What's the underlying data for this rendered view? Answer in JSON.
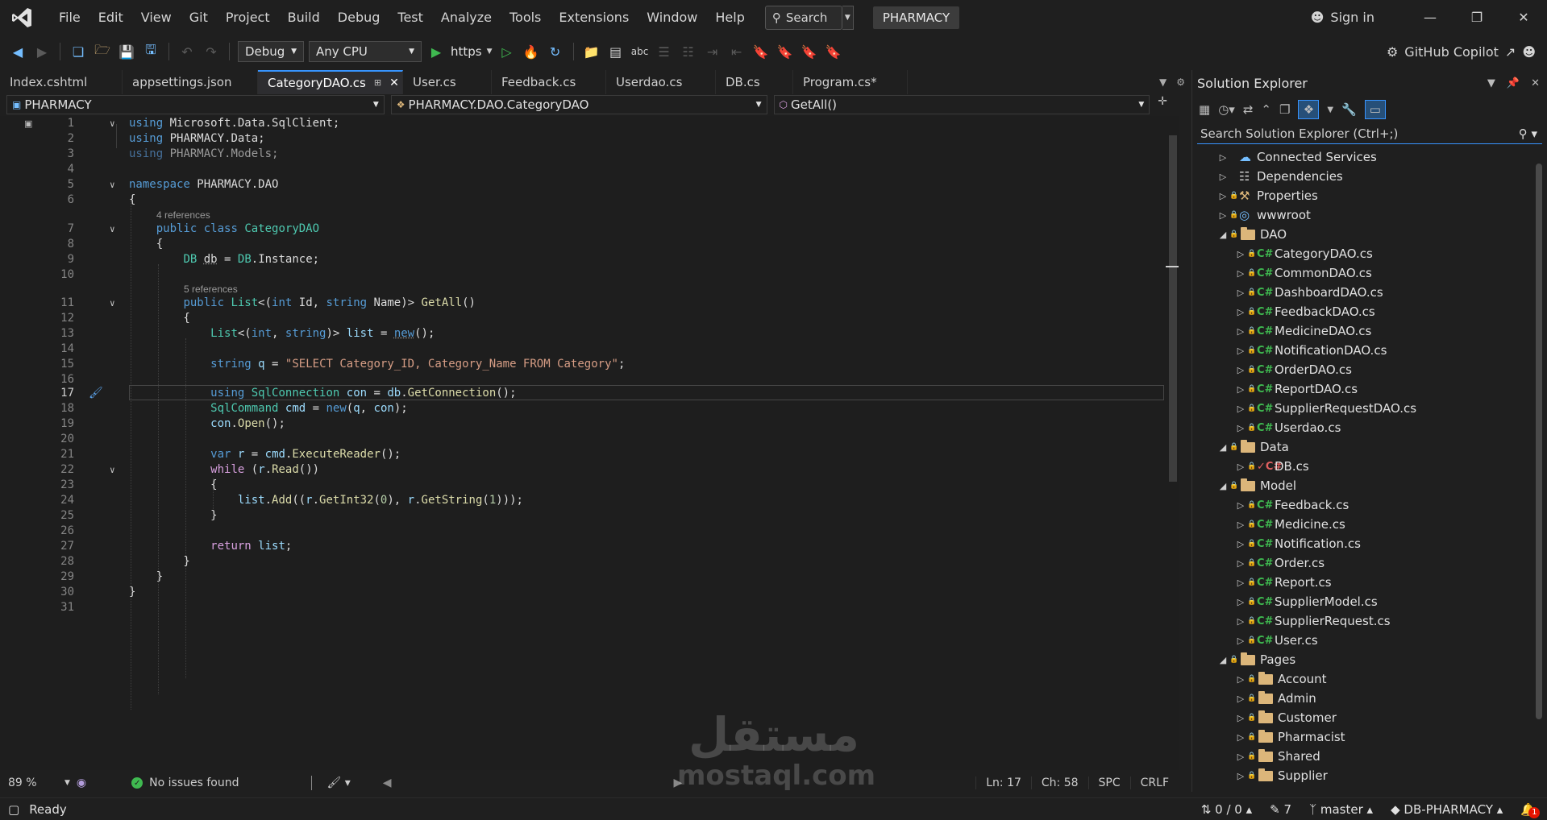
{
  "menubar": {
    "items": [
      "File",
      "Edit",
      "View",
      "Git",
      "Project",
      "Build",
      "Debug",
      "Test",
      "Analyze",
      "Tools",
      "Extensions",
      "Window",
      "Help"
    ],
    "search_label": "Search",
    "solution_name": "PHARMACY",
    "signin_label": "Sign in"
  },
  "toolbar": {
    "configuration": "Debug",
    "platform": "Any CPU",
    "run_target": "https",
    "copilot_label": "GitHub Copilot"
  },
  "tabs": [
    {
      "label": "Index.cshtml",
      "active": false
    },
    {
      "label": "appsettings.json",
      "active": false
    },
    {
      "label": "CategoryDAO.cs",
      "active": true
    },
    {
      "label": "User.cs",
      "active": false
    },
    {
      "label": "Feedback.cs",
      "active": false
    },
    {
      "label": "Userdao.cs",
      "active": false
    },
    {
      "label": "DB.cs",
      "active": false
    },
    {
      "label": "Program.cs*",
      "active": false
    }
  ],
  "navbar": {
    "project": "PHARMACY",
    "type": "PHARMACY.DAO.CategoryDAO",
    "member": "GetAll()"
  },
  "editor": {
    "codelens_class": "4 references",
    "codelens_method": "5 references",
    "current_line": 17
  },
  "editor_status": {
    "zoom": "89 %",
    "issues": "No issues found",
    "line": "Ln: 17",
    "col": "Ch: 58",
    "whitespace": "SPC",
    "line_ending": "CRLF"
  },
  "solution_explorer": {
    "title": "Solution Explorer",
    "search_placeholder": "Search Solution Explorer (Ctrl+;)",
    "items": [
      {
        "label": "Connected Services",
        "depth": 0,
        "kind": "service",
        "expanded": false
      },
      {
        "label": "Dependencies",
        "depth": 0,
        "kind": "deps",
        "expanded": false
      },
      {
        "label": "Properties",
        "depth": 0,
        "kind": "props",
        "expanded": false
      },
      {
        "label": "wwwroot",
        "depth": 0,
        "kind": "web",
        "expanded": false
      },
      {
        "label": "DAO",
        "depth": 0,
        "kind": "folder",
        "expanded": true
      },
      {
        "label": "CategoryDAO.cs",
        "depth": 1,
        "kind": "cs"
      },
      {
        "label": "CommonDAO.cs",
        "depth": 1,
        "kind": "cs"
      },
      {
        "label": "DashboardDAO.cs",
        "depth": 1,
        "kind": "cs"
      },
      {
        "label": "FeedbackDAO.cs",
        "depth": 1,
        "kind": "cs"
      },
      {
        "label": "MedicineDAO.cs",
        "depth": 1,
        "kind": "cs"
      },
      {
        "label": "NotificationDAO.cs",
        "depth": 1,
        "kind": "cs"
      },
      {
        "label": "OrderDAO.cs",
        "depth": 1,
        "kind": "cs"
      },
      {
        "label": "ReportDAO.cs",
        "depth": 1,
        "kind": "cs"
      },
      {
        "label": "SupplierRequestDAO.cs",
        "depth": 1,
        "kind": "cs"
      },
      {
        "label": "Userdao.cs",
        "depth": 1,
        "kind": "cs"
      },
      {
        "label": "Data",
        "depth": 0,
        "kind": "folder",
        "expanded": true
      },
      {
        "label": "DB.cs",
        "depth": 1,
        "kind": "cs-mod"
      },
      {
        "label": "Model",
        "depth": 0,
        "kind": "folder",
        "expanded": true
      },
      {
        "label": "Feedback.cs",
        "depth": 1,
        "kind": "cs"
      },
      {
        "label": "Medicine.cs",
        "depth": 1,
        "kind": "cs"
      },
      {
        "label": "Notification.cs",
        "depth": 1,
        "kind": "cs"
      },
      {
        "label": "Order.cs",
        "depth": 1,
        "kind": "cs"
      },
      {
        "label": "Report.cs",
        "depth": 1,
        "kind": "cs"
      },
      {
        "label": "SupplierModel.cs",
        "depth": 1,
        "kind": "cs"
      },
      {
        "label": "SupplierRequest.cs",
        "depth": 1,
        "kind": "cs"
      },
      {
        "label": "User.cs",
        "depth": 1,
        "kind": "cs"
      },
      {
        "label": "Pages",
        "depth": 0,
        "kind": "folder",
        "expanded": true
      },
      {
        "label": "Account",
        "depth": 1,
        "kind": "subfolder"
      },
      {
        "label": "Admin",
        "depth": 1,
        "kind": "subfolder"
      },
      {
        "label": "Customer",
        "depth": 1,
        "kind": "subfolder"
      },
      {
        "label": "Pharmacist",
        "depth": 1,
        "kind": "subfolder"
      },
      {
        "label": "Shared",
        "depth": 1,
        "kind": "subfolder"
      },
      {
        "label": "Supplier",
        "depth": 1,
        "kind": "subfolder"
      }
    ]
  },
  "statusbar": {
    "state": "Ready",
    "changes": "0 / 0",
    "edits": "7",
    "branch": "master",
    "repo": "DB-PHARMACY",
    "notifications": "1"
  },
  "watermark": {
    "arabic": "مستقل",
    "latin": "mostaql.com"
  },
  "colors": {
    "accent": "#3794ff",
    "keyword": "#569cd6",
    "type": "#4ec9b0",
    "string": "#d69d85",
    "method": "#dcdcaa",
    "csharp_icon": "#3fb950",
    "folder": "#dcb67a"
  }
}
